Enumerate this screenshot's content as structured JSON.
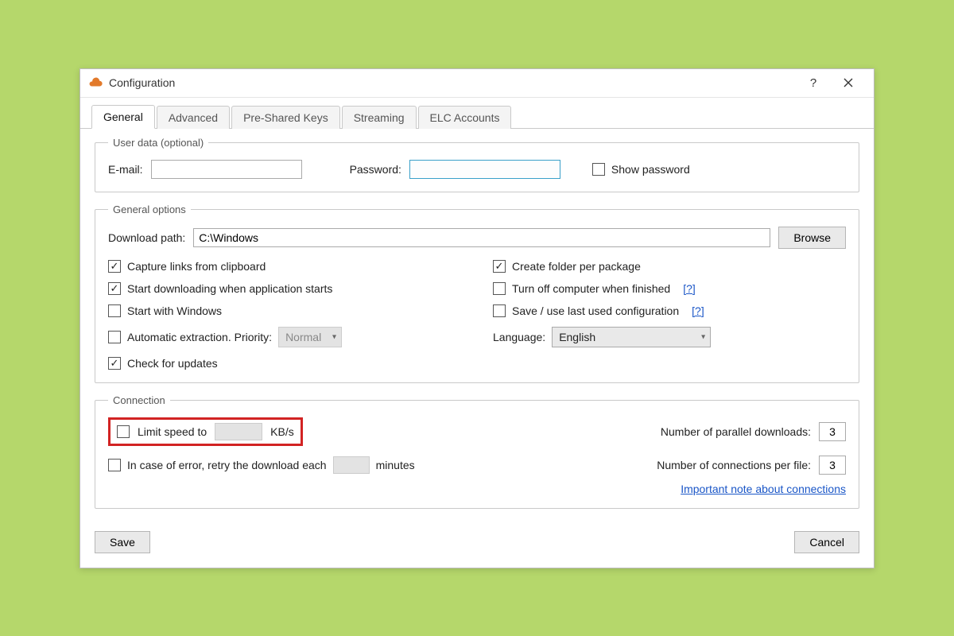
{
  "window": {
    "title": "Configuration"
  },
  "tabs": {
    "general": "General",
    "advanced": "Advanced",
    "psk": "Pre-Shared Keys",
    "streaming": "Streaming",
    "elc": "ELC Accounts"
  },
  "user_data": {
    "legend": "User data (optional)",
    "email_label": "E-mail:",
    "email_value": "",
    "password_label": "Password:",
    "password_value": "",
    "show_password_label": "Show password",
    "show_password_checked": false
  },
  "general_options": {
    "legend": "General options",
    "download_path_label": "Download path:",
    "download_path_value": "C:\\Windows",
    "browse_label": "Browse",
    "capture_links": {
      "label": "Capture links from clipboard",
      "checked": true
    },
    "start_download_on_launch": {
      "label": "Start downloading when application starts",
      "checked": true
    },
    "start_with_windows": {
      "label": "Start with Windows",
      "checked": false
    },
    "auto_extraction": {
      "label": "Automatic extraction. Priority:",
      "checked": false,
      "priority_value": "Normal"
    },
    "check_updates": {
      "label": "Check for updates",
      "checked": true
    },
    "create_folder": {
      "label": "Create folder per package",
      "checked": true
    },
    "turn_off": {
      "label": "Turn off computer when finished",
      "checked": false,
      "help": "[?]"
    },
    "save_last_config": {
      "label": "Save / use last used configuration",
      "checked": false,
      "help": "[?]"
    },
    "language_label": "Language:",
    "language_value": "English"
  },
  "connection": {
    "legend": "Connection",
    "limit_speed": {
      "label": "Limit speed to",
      "checked": false,
      "value": "",
      "unit": "KB/s"
    },
    "retry": {
      "label": "In case of error, retry the download each",
      "checked": false,
      "value": "",
      "unit": "minutes"
    },
    "parallel_label": "Number of parallel downloads:",
    "parallel_value": "3",
    "per_file_label": "Number of connections per file:",
    "per_file_value": "3",
    "important_link": "Important note about connections"
  },
  "buttons": {
    "save": "Save",
    "cancel": "Cancel"
  }
}
